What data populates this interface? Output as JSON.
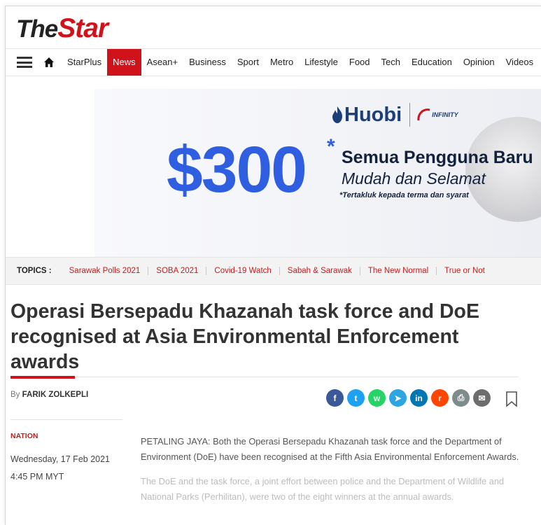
{
  "logo": {
    "the": "The",
    "star": "Star"
  },
  "nav": {
    "items": [
      "StarPlus",
      "News",
      "Asean+",
      "Business",
      "Sport",
      "Metro",
      "Lifestyle",
      "Food",
      "Tech",
      "Education",
      "Opinion",
      "Videos"
    ],
    "active": "News"
  },
  "ad": {
    "brand": "Huobi",
    "partner": "INFINITY",
    "amount": "$300",
    "asterisk": "*",
    "line1": "Semua Pengguna Baru",
    "line2": "Mudah dan Selamat",
    "disclaimer": "*Tertakluk kepada terma dan syarat"
  },
  "topics": {
    "label": "TOPICS :",
    "items": [
      "Sarawak Polls 2021",
      "SOBA 2021",
      "Covid-19 Watch",
      "Sabah & Sarawak",
      "The New Normal",
      "True or Not"
    ]
  },
  "article": {
    "headline": "Operasi Bersepadu Khazanah task force and DoE recognised at Asia Environmental Enforcement awards",
    "by": "By",
    "author": "FARIK ZOLKEPLI",
    "category": "NATION",
    "date": "Wednesday, 17 Feb 2021",
    "time": "4:45 PM MYT",
    "paragraphs": [
      "PETALING JAYA: Both the Operasi Bersepadu Khazanah task force and the Department of Environment (DoE) have been recognised at the Fifth Asia Environmental Enforcement Awards.",
      "The DoE and the task force, a joint effort between police and the Department of Wildlife and National Parks (Perhilitan), were two of the eight winners at the annual awards."
    ]
  },
  "share": [
    {
      "name": "facebook",
      "glyph": "f",
      "color": "#3b5998"
    },
    {
      "name": "twitter",
      "glyph": "t",
      "color": "#1da1f2"
    },
    {
      "name": "whatsapp",
      "glyph": "w",
      "color": "#25d366"
    },
    {
      "name": "telegram",
      "glyph": "➤",
      "color": "#2ca5e0"
    },
    {
      "name": "linkedin",
      "glyph": "in",
      "color": "#0077b5"
    },
    {
      "name": "reddit",
      "glyph": "r",
      "color": "#ff4500"
    },
    {
      "name": "print",
      "glyph": "⎙",
      "color": "#7f8c8d"
    },
    {
      "name": "email",
      "glyph": "✉",
      "color": "#6d6d6d"
    }
  ]
}
